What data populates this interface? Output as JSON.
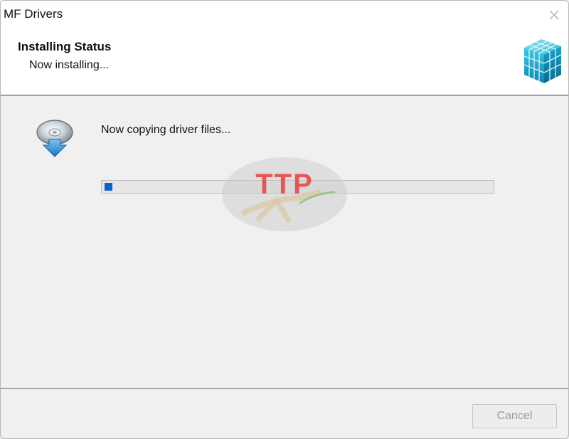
{
  "window": {
    "title": "MF Drivers",
    "close_icon": "close-icon"
  },
  "header": {
    "title": "Installing Status",
    "subtitle": "Now installing...",
    "icon": "cube-icon"
  },
  "content": {
    "status_text": "Now copying driver files...",
    "icon": "disc-install-icon",
    "progress": 0.02,
    "progress_color": "#0a64c8"
  },
  "footer": {
    "cancel_label": "Cancel",
    "cancel_enabled": false
  },
  "watermark": {
    "text": "TTP",
    "color": "#e8413a"
  }
}
